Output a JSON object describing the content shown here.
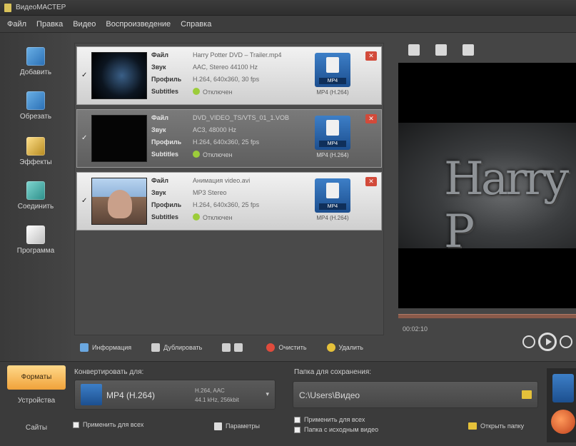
{
  "window": {
    "title": "ВидеоМАСТЕР"
  },
  "menu": [
    "Файл",
    "Правка",
    "Видео",
    "Воспроизведение",
    "Справка"
  ],
  "left_toolbar": [
    {
      "label": "Добавить",
      "icon": "add-video-icon"
    },
    {
      "label": "Обрезать",
      "icon": "cut-icon"
    },
    {
      "label": "Эффекты",
      "icon": "effects-icon"
    },
    {
      "label": "Соединить",
      "icon": "join-icon"
    },
    {
      "label": "Программа",
      "icon": "program-icon"
    }
  ],
  "files": [
    {
      "checked": "✓",
      "meta": [
        {
          "k": "Файл",
          "v": "Harry Potter DVD – Trailer.mp4"
        },
        {
          "k": "Звук",
          "v": "AAC, Stereo 44100 Hz"
        },
        {
          "k": "Профиль",
          "v": "H.264, 640x360, 30 fps"
        },
        {
          "k": "Subtitles",
          "v": "Отключен"
        }
      ],
      "format_tag": "MP4",
      "size": "MP4 (H.264)"
    },
    {
      "checked": "✓",
      "meta": [
        {
          "k": "Файл",
          "v": "DVD_VIDEO_TS/VTS_01_1.VOB"
        },
        {
          "k": "Звук",
          "v": "AC3, 48000 Hz"
        },
        {
          "k": "Профиль",
          "v": "H.264, 640x360, 25 fps"
        },
        {
          "k": "Subtitles",
          "v": "Отключен"
        }
      ],
      "format_tag": "MP4",
      "size": "MP4 (H.264)"
    },
    {
      "checked": "✓",
      "meta": [
        {
          "k": "Файл",
          "v": "Анимация video.avi"
        },
        {
          "k": "Звук",
          "v": "MP3 Stereo"
        },
        {
          "k": "Профиль",
          "v": "H.264, 640x360, 25 fps"
        },
        {
          "k": "Subtitles",
          "v": "Отключен"
        }
      ],
      "format_tag": "MP4",
      "size": "MP4 (H.264)"
    }
  ],
  "list_toolbar": [
    {
      "label": "Информация",
      "icon": "info-icon"
    },
    {
      "label": "Дублировать",
      "icon": "duplicate-icon"
    },
    {
      "label": "",
      "icon": "view-toggle-icon"
    },
    {
      "label": "Очистить",
      "icon": "clear-icon"
    },
    {
      "label": "Удалить",
      "icon": "delete-icon"
    }
  ],
  "preview": {
    "title_text": "Harry P",
    "timecode": "00:02:10"
  },
  "tabs": {
    "formats": "Форматы",
    "devices": "Устройства",
    "sites": "Сайты"
  },
  "convert_for": {
    "label": "Конвертировать для:",
    "format": "MP4 (H.264)",
    "details_1": "H.264, AAC",
    "details_2": "44.1 kHz, 256kbit",
    "dropdown": "▾",
    "apply_all": "Применить для всех",
    "params": "Параметры"
  },
  "save_folder": {
    "label": "Папка для сохранения:",
    "path": "C:\\Users\\Видео",
    "apply_all": "Применить для всех",
    "source_folder": "Папка с исходным видео",
    "open_folder": "Открыть папку"
  }
}
